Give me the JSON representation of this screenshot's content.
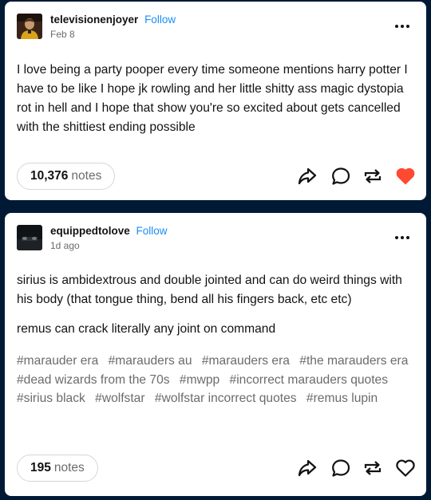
{
  "posts": [
    {
      "username": "televisionenjoyer",
      "follow_label": "Follow",
      "date": "Feb 8",
      "paragraphs": [
        "I love being a party pooper every time someone mentions harry potter I have to be like I hope jk rowling and her little shitty ass magic dystopia rot in hell and I hope that show you're so excited about gets cancelled with the shittiest ending possible"
      ],
      "tags": [],
      "notes_count": "10,376",
      "notes_label": "notes",
      "liked": true,
      "like_color": "#ff4930"
    },
    {
      "username": "equippedtolove",
      "follow_label": "Follow",
      "date": "1d ago",
      "paragraphs": [
        "sirius is ambidextrous and double jointed and can do weird things with his body (that tongue thing, bend all his fingers back, etc etc)",
        "remus can crack literally any joint on command"
      ],
      "tags": [
        "#marauder era",
        "#marauders au",
        "#marauders era",
        "#the marauders era",
        "#dead wizards from the 70s",
        "#mwpp",
        "#incorrect marauders quotes",
        "#sirius black",
        "#wolfstar",
        "#wolfstar incorrect quotes",
        "#remus lupin"
      ],
      "notes_count": "195",
      "notes_label": "notes",
      "liked": false
    }
  ],
  "icons": {
    "more": "more-horizontal-icon",
    "share": "share-arrow-icon",
    "reply": "speech-bubble-icon",
    "reblog": "reblog-icon",
    "like": "heart-icon"
  },
  "colors": {
    "background": "#001935",
    "card": "#ffffff",
    "follow": "#1a8ef5",
    "icon": "#121212",
    "muted": "#6b6b6b"
  }
}
